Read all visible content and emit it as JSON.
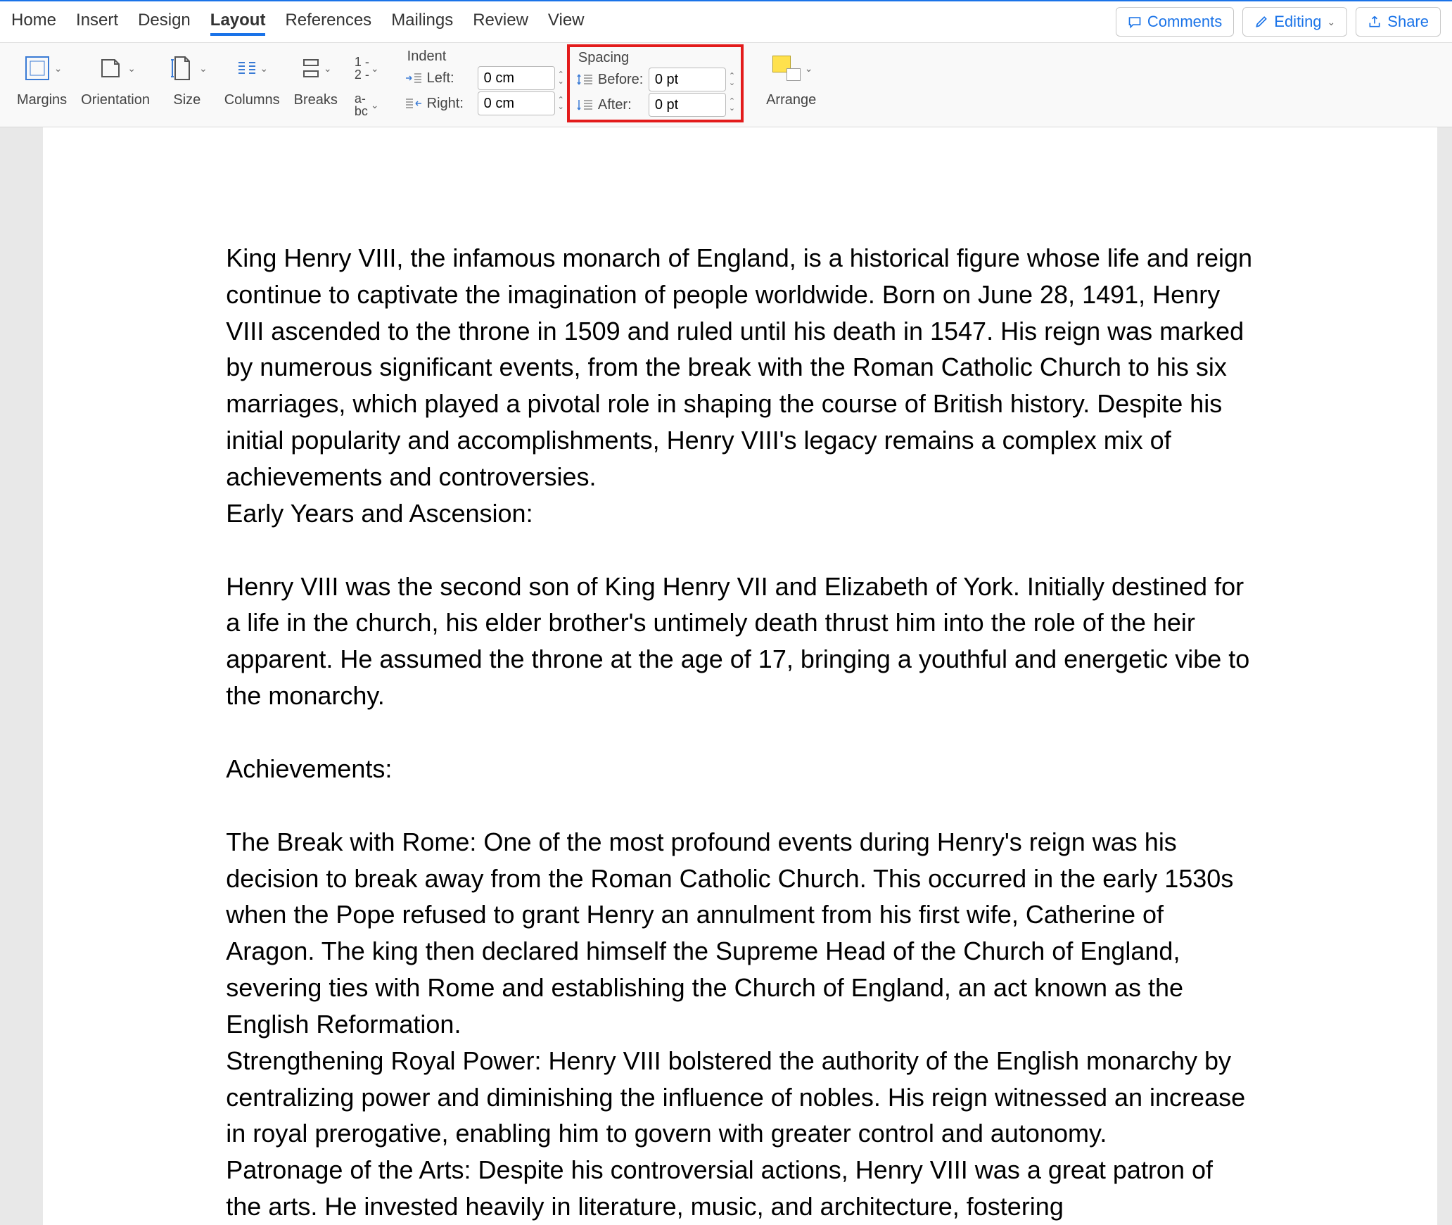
{
  "tabs": {
    "home": "Home",
    "insert": "Insert",
    "design": "Design",
    "layout": "Layout",
    "references": "References",
    "mailings": "Mailings",
    "review": "Review",
    "view": "View"
  },
  "actions": {
    "comments": "Comments",
    "editing": "Editing",
    "share": "Share"
  },
  "ribbon": {
    "margins": "Margins",
    "orientation": "Orientation",
    "size": "Size",
    "columns": "Columns",
    "breaks": "Breaks",
    "hyphenation": "a-\nbc",
    "indent": {
      "title": "Indent",
      "left_label": "Left:",
      "left_value": "0 cm",
      "right_label": "Right:",
      "right_value": "0 cm"
    },
    "spacing": {
      "title": "Spacing",
      "before_label": "Before:",
      "before_value": "0 pt",
      "after_label": "After:",
      "after_value": "0 pt"
    },
    "arrange": "Arrange"
  },
  "document": {
    "p1": "King Henry VIII, the infamous monarch of England, is a historical figure whose life and reign continue to captivate the imagination of people worldwide. Born on June 28, 1491, Henry VIII ascended to the throne in 1509 and ruled until his death in 1547. His reign was marked by numerous significant events, from the break with the Roman Catholic Church to his six marriages, which played a pivotal role in shaping the course of British history. Despite his initial popularity and accomplishments, Henry VIII's legacy remains a complex mix of achievements and controversies.",
    "p2": "Early Years and Ascension:",
    "p3": "Henry VIII was the second son of King Henry VII and Elizabeth of York. Initially destined for a life in the church, his elder brother's untimely death thrust him into the role of the heir apparent. He assumed the throne at the age of 17, bringing a youthful and energetic vibe to the monarchy.",
    "p4": "Achievements:",
    "p5": "The Break with Rome: One of the most profound events during Henry's reign was his decision to break away from the Roman Catholic Church. This occurred in the early 1530s when the Pope refused to grant Henry an annulment from his first wife, Catherine of Aragon. The king then declared himself the Supreme Head of the Church of England, severing ties with Rome and establishing the Church of England, an act known as the English Reformation.",
    "p6": "Strengthening Royal Power: Henry VIII bolstered the authority of the English monarchy by centralizing power and diminishing the influence of nobles. His reign witnessed an increase in royal prerogative, enabling him to govern with greater control and autonomy.",
    "p7": "Patronage of the Arts: Despite his controversial actions, Henry VIII was a great patron of the arts. He invested heavily in literature, music, and architecture, fostering"
  }
}
